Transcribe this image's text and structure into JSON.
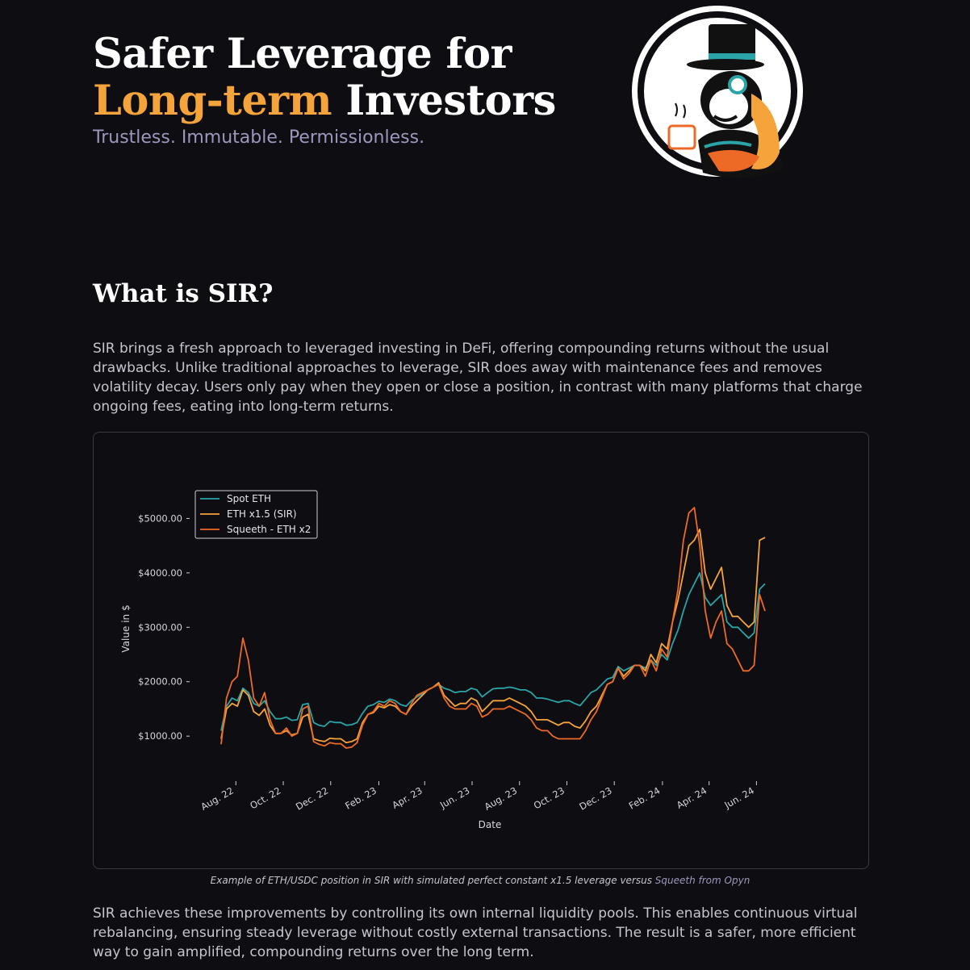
{
  "colors": {
    "accent": "#f5a43b",
    "spot": "#2aa4a6",
    "sir": "#f5a43b",
    "squeeth": "#ec6a26"
  },
  "hero": {
    "title_line1": "Safer Leverage for",
    "title_accent": "Long-term",
    "title_line2_rest": "Investors",
    "tagline": "Trustless. Immutable. Permissionless."
  },
  "logo": {
    "icon": "monkey-top-hat-mascot-icon"
  },
  "section": {
    "title": "What is SIR?",
    "para1": "SIR brings a fresh approach to leveraged investing in DeFi, offering compounding returns without the usual drawbacks. Unlike traditional approaches to leverage, SIR does away with maintenance fees and removes volatility decay. Users only pay when they open or close a position, in contrast with many platforms that charge ongoing fees, eating into long-term returns.",
    "para2": "SIR achieves these improvements by controlling its own internal liquidity pools. This enables continuous virtual rebalancing, ensuring steady leverage without costly external transactions. The result is a safer, more efficient way to gain amplified, compounding returns over the long term."
  },
  "caption": {
    "text": "Example of ETH/USDC position in SIR with simulated perfect constant x1.5 leverage versus ",
    "link": "Squeeth from Opyn"
  },
  "chart_data": {
    "type": "line",
    "xlabel": "Date",
    "ylabel": "Value in $",
    "ylim": [
      350,
      5600
    ],
    "yticks": [
      1000,
      2000,
      3000,
      4000,
      5000
    ],
    "ytick_labels": [
      "$1000.00",
      "$2000.00",
      "$3000.00",
      "$4000.00",
      "$5000.00"
    ],
    "xticks": [
      "2022-08-01",
      "2022-10-01",
      "2022-12-01",
      "2023-02-01",
      "2023-04-01",
      "2023-06-01",
      "2023-08-01",
      "2023-10-01",
      "2023-12-01",
      "2024-02-01",
      "2024-04-01",
      "2024-06-01"
    ],
    "xtick_labels": [
      "Aug. 22",
      "Oct. 22",
      "Dec. 22",
      "Feb. 23",
      "Apr. 23",
      "Jun. 23",
      "Aug. 23",
      "Oct. 23",
      "Dec. 23",
      "Feb. 24",
      "Apr. 24",
      "Jun. 24"
    ],
    "legend_position": "top-left",
    "grid": false,
    "x": [
      "2022-07-13",
      "2022-07-20",
      "2022-07-27",
      "2022-08-03",
      "2022-08-10",
      "2022-08-17",
      "2022-08-24",
      "2022-08-31",
      "2022-09-07",
      "2022-09-14",
      "2022-09-21",
      "2022-09-28",
      "2022-10-05",
      "2022-10-12",
      "2022-10-19",
      "2022-10-26",
      "2022-11-02",
      "2022-11-09",
      "2022-11-16",
      "2022-11-23",
      "2022-11-30",
      "2022-12-07",
      "2022-12-14",
      "2022-12-21",
      "2022-12-28",
      "2023-01-04",
      "2023-01-11",
      "2023-01-18",
      "2023-01-25",
      "2023-02-01",
      "2023-02-08",
      "2023-02-15",
      "2023-02-22",
      "2023-03-01",
      "2023-03-08",
      "2023-03-15",
      "2023-03-22",
      "2023-03-29",
      "2023-04-05",
      "2023-04-12",
      "2023-04-19",
      "2023-04-26",
      "2023-05-03",
      "2023-05-10",
      "2023-05-17",
      "2023-05-24",
      "2023-05-31",
      "2023-06-07",
      "2023-06-14",
      "2023-06-21",
      "2023-06-28",
      "2023-07-05",
      "2023-07-12",
      "2023-07-19",
      "2023-07-26",
      "2023-08-02",
      "2023-08-09",
      "2023-08-16",
      "2023-08-23",
      "2023-08-30",
      "2023-09-06",
      "2023-09-13",
      "2023-09-20",
      "2023-09-27",
      "2023-10-04",
      "2023-10-11",
      "2023-10-18",
      "2023-10-25",
      "2023-11-01",
      "2023-11-08",
      "2023-11-15",
      "2023-11-22",
      "2023-11-29",
      "2023-12-06",
      "2023-12-13",
      "2023-12-20",
      "2023-12-27",
      "2024-01-03",
      "2024-01-10",
      "2024-01-17",
      "2024-01-24",
      "2024-01-31",
      "2024-02-07",
      "2024-02-14",
      "2024-02-21",
      "2024-02-28",
      "2024-03-06",
      "2024-03-13",
      "2024-03-20",
      "2024-03-27",
      "2024-04-03",
      "2024-04-10",
      "2024-04-17",
      "2024-04-24",
      "2024-05-01",
      "2024-05-08",
      "2024-05-15",
      "2024-05-22",
      "2024-05-29",
      "2024-06-05",
      "2024-06-12"
    ],
    "series": [
      {
        "name": "Spot ETH",
        "color_key": "spot",
        "values": [
          1100,
          1550,
          1700,
          1650,
          1880,
          1800,
          1600,
          1550,
          1650,
          1450,
          1320,
          1320,
          1350,
          1290,
          1300,
          1580,
          1600,
          1250,
          1200,
          1180,
          1270,
          1250,
          1250,
          1200,
          1210,
          1250,
          1420,
          1550,
          1580,
          1640,
          1620,
          1680,
          1650,
          1580,
          1550,
          1650,
          1720,
          1780,
          1850,
          1900,
          1950,
          1880,
          1850,
          1800,
          1820,
          1820,
          1880,
          1850,
          1720,
          1800,
          1870,
          1880,
          1880,
          1900,
          1880,
          1850,
          1850,
          1800,
          1700,
          1700,
          1680,
          1650,
          1620,
          1650,
          1650,
          1600,
          1560,
          1680,
          1800,
          1850,
          1950,
          2050,
          2080,
          2280,
          2200,
          2250,
          2300,
          2300,
          2250,
          2400,
          2300,
          2500,
          2400,
          2700,
          2950,
          3300,
          3600,
          3800,
          4000,
          3550,
          3400,
          3500,
          3600,
          3100,
          3000,
          3000,
          2900,
          2800,
          2900,
          3700,
          3800
        ]
      },
      {
        "name": "ETH x1.5 (SIR)",
        "color_key": "sir",
        "values": [
          950,
          1500,
          1600,
          1550,
          1850,
          1750,
          1450,
          1380,
          1500,
          1200,
          1050,
          1050,
          1100,
          1020,
          1050,
          1350,
          1400,
          950,
          920,
          900,
          960,
          950,
          950,
          880,
          900,
          950,
          1250,
          1400,
          1430,
          1550,
          1520,
          1580,
          1550,
          1450,
          1400,
          1550,
          1650,
          1750,
          1850,
          1900,
          1980,
          1750,
          1650,
          1550,
          1600,
          1600,
          1700,
          1650,
          1450,
          1550,
          1650,
          1650,
          1650,
          1700,
          1650,
          1600,
          1550,
          1450,
          1300,
          1300,
          1300,
          1250,
          1200,
          1250,
          1250,
          1180,
          1150,
          1280,
          1450,
          1550,
          1750,
          1950,
          2000,
          2250,
          2100,
          2200,
          2300,
          2300,
          2200,
          2500,
          2350,
          2700,
          2600,
          3100,
          3500,
          4000,
          4500,
          4600,
          4800,
          4000,
          3700,
          3900,
          4100,
          3400,
          3200,
          3200,
          3100,
          3000,
          3100,
          4600,
          4650
        ]
      },
      {
        "name": "Squeeth - ETH x2",
        "color_key": "squeeth",
        "values": [
          850,
          1700,
          2000,
          2100,
          2800,
          2400,
          1700,
          1550,
          1800,
          1300,
          1050,
          1050,
          1150,
          1000,
          1050,
          1500,
          1550,
          900,
          850,
          820,
          880,
          860,
          860,
          780,
          800,
          880,
          1200,
          1400,
          1450,
          1600,
          1550,
          1650,
          1600,
          1450,
          1400,
          1600,
          1750,
          1800,
          1850,
          1900,
          1950,
          1700,
          1550,
          1500,
          1500,
          1500,
          1600,
          1550,
          1350,
          1400,
          1500,
          1500,
          1500,
          1550,
          1500,
          1450,
          1400,
          1300,
          1150,
          1100,
          1100,
          1000,
          950,
          950,
          950,
          950,
          950,
          1100,
          1300,
          1450,
          1700,
          1950,
          2000,
          2250,
          2050,
          2150,
          2300,
          2300,
          2100,
          2400,
          2200,
          2600,
          2450,
          3100,
          3700,
          4600,
          5100,
          5200,
          4500,
          3300,
          2800,
          3100,
          3300,
          2700,
          2600,
          2400,
          2200,
          2200,
          2300,
          3600,
          3300
        ]
      }
    ]
  }
}
